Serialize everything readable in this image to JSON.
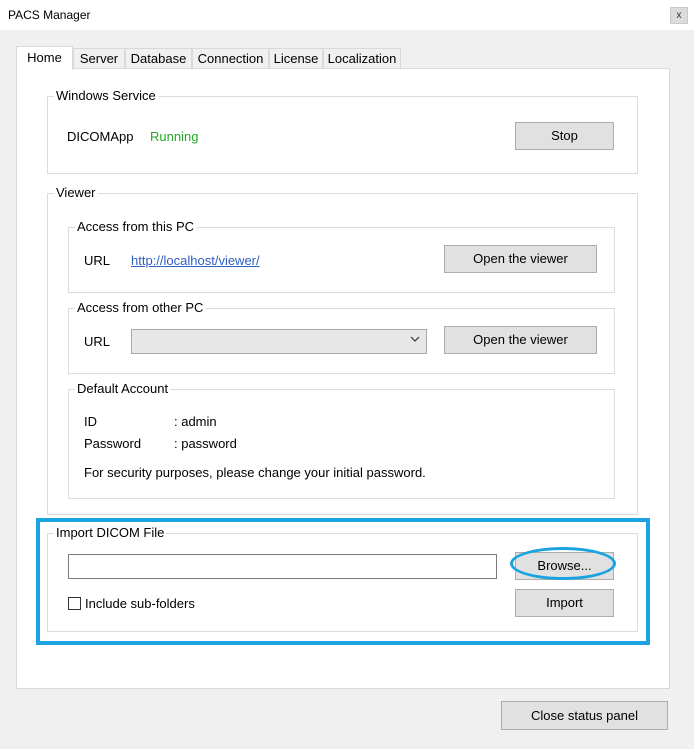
{
  "window": {
    "title": "PACS Manager",
    "close_glyph": "x"
  },
  "tabs": [
    {
      "label": "Home",
      "active": true
    },
    {
      "label": "Server"
    },
    {
      "label": "Database"
    },
    {
      "label": "Connection"
    },
    {
      "label": "License"
    },
    {
      "label": "Localization"
    }
  ],
  "windows_service": {
    "legend": "Windows Service",
    "service_name": "DICOMApp",
    "status": "Running",
    "status_color": "#22aa22",
    "stop_label": "Stop"
  },
  "viewer": {
    "legend": "Viewer",
    "local": {
      "legend": "Access from this PC",
      "url_label": "URL",
      "url": "http://localhost/viewer/",
      "open_label": "Open the viewer"
    },
    "remote": {
      "legend": "Access from other PC",
      "url_label": "URL",
      "selected_value": "",
      "open_label": "Open the viewer"
    },
    "account": {
      "legend": "Default Account",
      "id_label": "ID",
      "id_value": ": admin",
      "password_label": "Password",
      "password_value": ": password",
      "note": "For security purposes, please change your initial password."
    }
  },
  "import": {
    "legend": "Import DICOM File",
    "path_value": "",
    "browse_label": "Browse...",
    "include_subfolders_label": "Include sub-folders",
    "include_subfolders_checked": false,
    "import_label": "Import",
    "highlight_color": "#1aa3e0"
  },
  "footer": {
    "close_status_label": "Close status panel"
  }
}
